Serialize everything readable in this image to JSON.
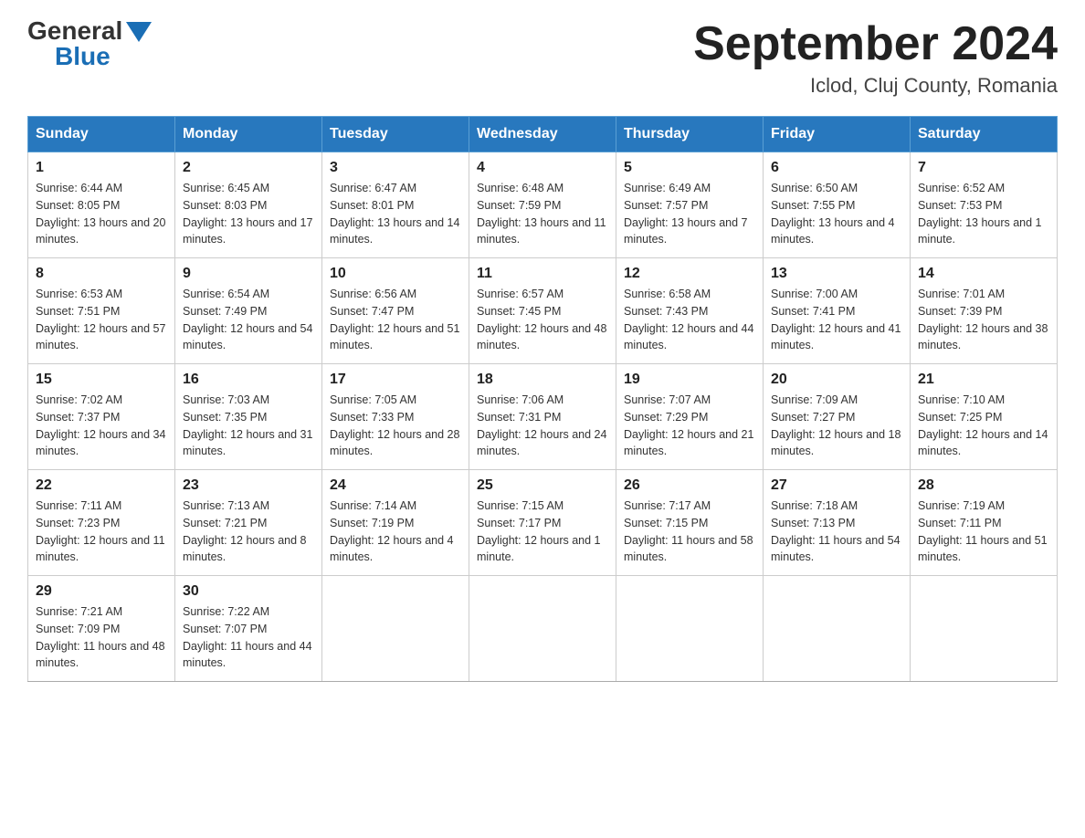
{
  "header": {
    "logo_general": "General",
    "logo_blue": "Blue",
    "month_title": "September 2024",
    "location": "Iclod, Cluj County, Romania"
  },
  "weekdays": [
    "Sunday",
    "Monday",
    "Tuesday",
    "Wednesday",
    "Thursday",
    "Friday",
    "Saturday"
  ],
  "weeks": [
    [
      {
        "day": "1",
        "sunrise": "6:44 AM",
        "sunset": "8:05 PM",
        "daylight": "13 hours and 20 minutes."
      },
      {
        "day": "2",
        "sunrise": "6:45 AM",
        "sunset": "8:03 PM",
        "daylight": "13 hours and 17 minutes."
      },
      {
        "day": "3",
        "sunrise": "6:47 AM",
        "sunset": "8:01 PM",
        "daylight": "13 hours and 14 minutes."
      },
      {
        "day": "4",
        "sunrise": "6:48 AM",
        "sunset": "7:59 PM",
        "daylight": "13 hours and 11 minutes."
      },
      {
        "day": "5",
        "sunrise": "6:49 AM",
        "sunset": "7:57 PM",
        "daylight": "13 hours and 7 minutes."
      },
      {
        "day": "6",
        "sunrise": "6:50 AM",
        "sunset": "7:55 PM",
        "daylight": "13 hours and 4 minutes."
      },
      {
        "day": "7",
        "sunrise": "6:52 AM",
        "sunset": "7:53 PM",
        "daylight": "13 hours and 1 minute."
      }
    ],
    [
      {
        "day": "8",
        "sunrise": "6:53 AM",
        "sunset": "7:51 PM",
        "daylight": "12 hours and 57 minutes."
      },
      {
        "day": "9",
        "sunrise": "6:54 AM",
        "sunset": "7:49 PM",
        "daylight": "12 hours and 54 minutes."
      },
      {
        "day": "10",
        "sunrise": "6:56 AM",
        "sunset": "7:47 PM",
        "daylight": "12 hours and 51 minutes."
      },
      {
        "day": "11",
        "sunrise": "6:57 AM",
        "sunset": "7:45 PM",
        "daylight": "12 hours and 48 minutes."
      },
      {
        "day": "12",
        "sunrise": "6:58 AM",
        "sunset": "7:43 PM",
        "daylight": "12 hours and 44 minutes."
      },
      {
        "day": "13",
        "sunrise": "7:00 AM",
        "sunset": "7:41 PM",
        "daylight": "12 hours and 41 minutes."
      },
      {
        "day": "14",
        "sunrise": "7:01 AM",
        "sunset": "7:39 PM",
        "daylight": "12 hours and 38 minutes."
      }
    ],
    [
      {
        "day": "15",
        "sunrise": "7:02 AM",
        "sunset": "7:37 PM",
        "daylight": "12 hours and 34 minutes."
      },
      {
        "day": "16",
        "sunrise": "7:03 AM",
        "sunset": "7:35 PM",
        "daylight": "12 hours and 31 minutes."
      },
      {
        "day": "17",
        "sunrise": "7:05 AM",
        "sunset": "7:33 PM",
        "daylight": "12 hours and 28 minutes."
      },
      {
        "day": "18",
        "sunrise": "7:06 AM",
        "sunset": "7:31 PM",
        "daylight": "12 hours and 24 minutes."
      },
      {
        "day": "19",
        "sunrise": "7:07 AM",
        "sunset": "7:29 PM",
        "daylight": "12 hours and 21 minutes."
      },
      {
        "day": "20",
        "sunrise": "7:09 AM",
        "sunset": "7:27 PM",
        "daylight": "12 hours and 18 minutes."
      },
      {
        "day": "21",
        "sunrise": "7:10 AM",
        "sunset": "7:25 PM",
        "daylight": "12 hours and 14 minutes."
      }
    ],
    [
      {
        "day": "22",
        "sunrise": "7:11 AM",
        "sunset": "7:23 PM",
        "daylight": "12 hours and 11 minutes."
      },
      {
        "day": "23",
        "sunrise": "7:13 AM",
        "sunset": "7:21 PM",
        "daylight": "12 hours and 8 minutes."
      },
      {
        "day": "24",
        "sunrise": "7:14 AM",
        "sunset": "7:19 PM",
        "daylight": "12 hours and 4 minutes."
      },
      {
        "day": "25",
        "sunrise": "7:15 AM",
        "sunset": "7:17 PM",
        "daylight": "12 hours and 1 minute."
      },
      {
        "day": "26",
        "sunrise": "7:17 AM",
        "sunset": "7:15 PM",
        "daylight": "11 hours and 58 minutes."
      },
      {
        "day": "27",
        "sunrise": "7:18 AM",
        "sunset": "7:13 PM",
        "daylight": "11 hours and 54 minutes."
      },
      {
        "day": "28",
        "sunrise": "7:19 AM",
        "sunset": "7:11 PM",
        "daylight": "11 hours and 51 minutes."
      }
    ],
    [
      {
        "day": "29",
        "sunrise": "7:21 AM",
        "sunset": "7:09 PM",
        "daylight": "11 hours and 48 minutes."
      },
      {
        "day": "30",
        "sunrise": "7:22 AM",
        "sunset": "7:07 PM",
        "daylight": "11 hours and 44 minutes."
      },
      null,
      null,
      null,
      null,
      null
    ]
  ]
}
